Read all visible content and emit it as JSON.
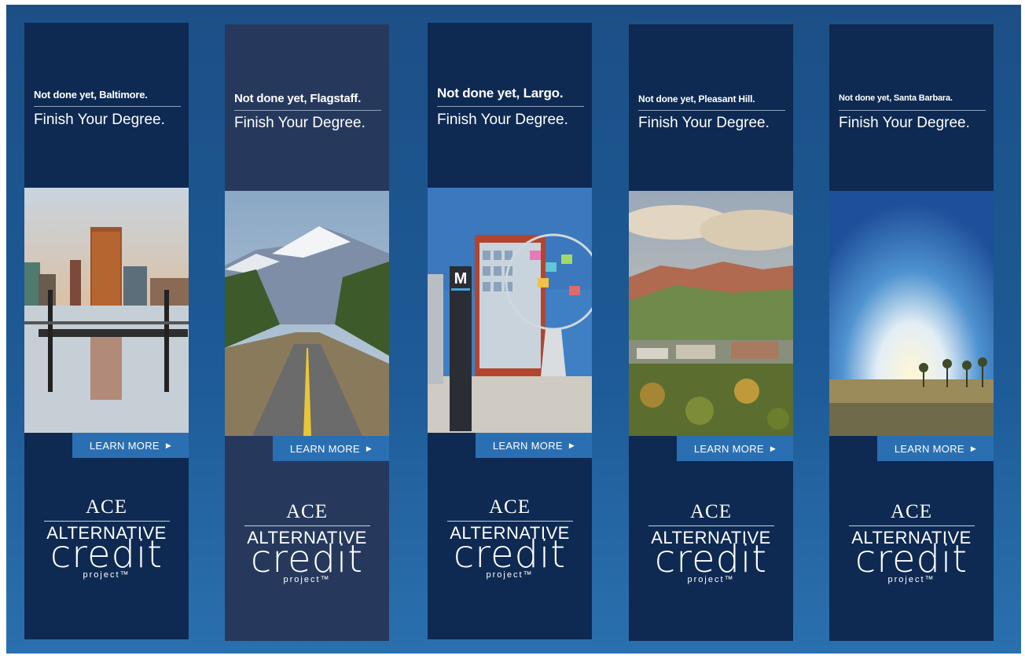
{
  "banners": [
    {
      "headline": "Not done yet, Baltimore.",
      "tagline": "Finish Your Degree.",
      "cta": "LEARN MORE",
      "scene": "baltimore-harbor-skyline"
    },
    {
      "headline": "Not done yet, Flagstaff.",
      "tagline": "Finish Your Degree.",
      "cta": "LEARN MORE",
      "scene": "flagstaff-mountain-road"
    },
    {
      "headline": "Not done yet, Largo.",
      "tagline": "Finish Your Degree.",
      "cta": "LEARN MORE",
      "scene": "largo-metro-station"
    },
    {
      "headline": "Not done yet, Pleasant Hill.",
      "tagline": "Finish Your Degree.",
      "cta": "LEARN MORE",
      "scene": "pleasant-hill-hills"
    },
    {
      "headline": "Not done yet, Santa Barbara.",
      "tagline": "Finish Your Degree.",
      "cta": "LEARN MORE",
      "scene": "santa-barbara-sunset"
    }
  ],
  "logo": {
    "ace": "ACE",
    "line1": "ALTERNATIVE",
    "line2": "credit",
    "line3": "project™"
  },
  "colors": {
    "banner": "#0e2a52",
    "banner_alt": "#26395d",
    "button": "#2b6fb3",
    "background": "#1d5a96"
  }
}
